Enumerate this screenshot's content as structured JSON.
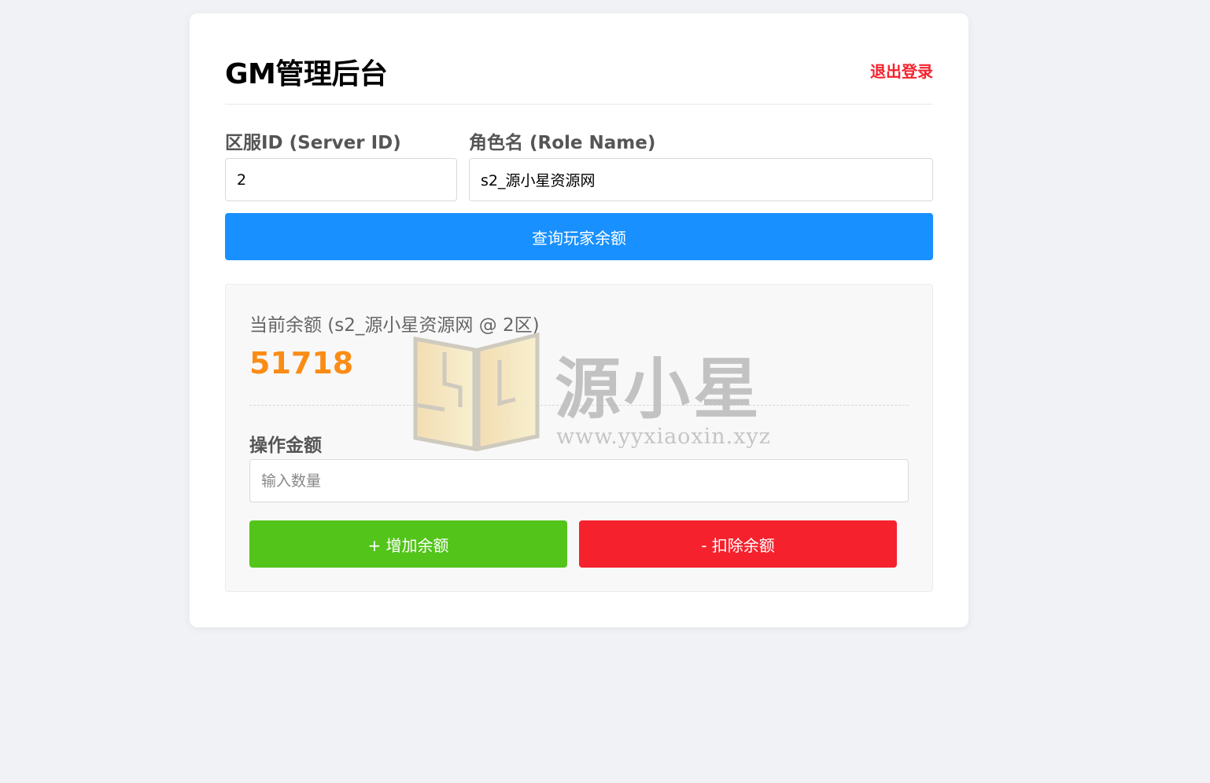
{
  "header": {
    "title": "GM管理后台",
    "logout": "退出登录"
  },
  "form": {
    "server_label": "区服ID (Server ID)",
    "server_value": "2",
    "role_label": "角色名 (Role Name)",
    "role_value": "s2_源小星资源网",
    "query_button": "查询玩家余额"
  },
  "result": {
    "balance_label": "当前余额 (s2_源小星资源网 @ 2区)",
    "balance_value": "51718",
    "amount_label": "操作金额",
    "amount_placeholder": "输入数量",
    "add_button": "+ 增加余额",
    "deduct_button": "- 扣除余额"
  },
  "watermark": {
    "text": "源小星",
    "url": "www.yyxiaoxin.xyz"
  },
  "colors": {
    "primary": "#1890ff",
    "success": "#52c41a",
    "danger": "#f5222d",
    "balance": "#fa8c16"
  }
}
